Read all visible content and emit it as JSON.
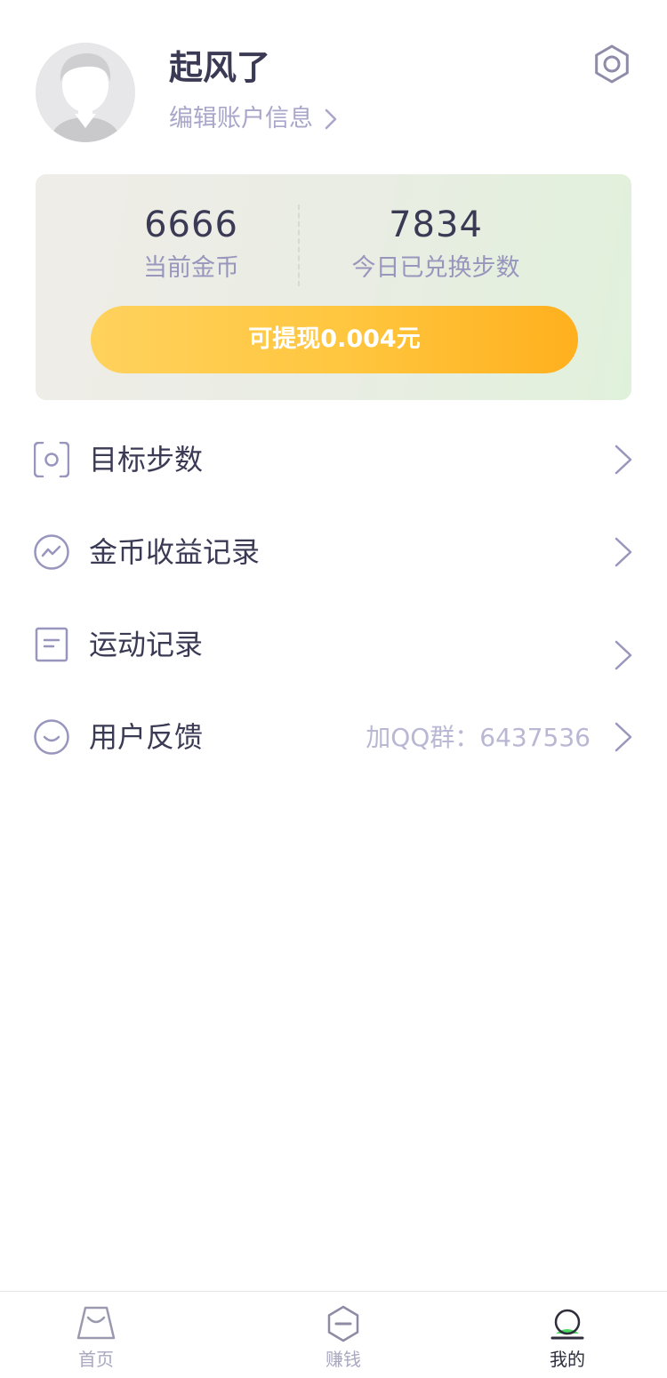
{
  "profile": {
    "username": "起风了",
    "edit_label": "编辑账户信息"
  },
  "stats": {
    "coins_value": "6666",
    "coins_label": "当前金币",
    "steps_value": "7834",
    "steps_label": "今日已兑换步数",
    "withdraw_label": "可提现0.004元"
  },
  "menu": {
    "items": [
      {
        "label": "目标步数",
        "icon": "target-icon",
        "extra": ""
      },
      {
        "label": "金币收益记录",
        "icon": "trend-chart-icon",
        "extra": ""
      },
      {
        "label": "运动记录",
        "icon": "document-icon",
        "extra": ""
      },
      {
        "label": "用户反馈",
        "icon": "smile-icon",
        "extra": "加QQ群：6437536"
      }
    ]
  },
  "tabbar": {
    "tabs": [
      {
        "label": "首页",
        "icon": "shopping-bag-icon",
        "active": false
      },
      {
        "label": "赚钱",
        "icon": "hexagon-coin-icon",
        "active": false
      },
      {
        "label": "我的",
        "icon": "user-profile-icon",
        "active": true
      }
    ]
  },
  "colors": {
    "primary_text": "#3b3a55",
    "secondary_text": "#a9a6c9",
    "withdraw_gradient_start": "#ffd25d",
    "withdraw_gradient_end": "#ffb01e",
    "active_tab_accent": "#4cd964"
  }
}
